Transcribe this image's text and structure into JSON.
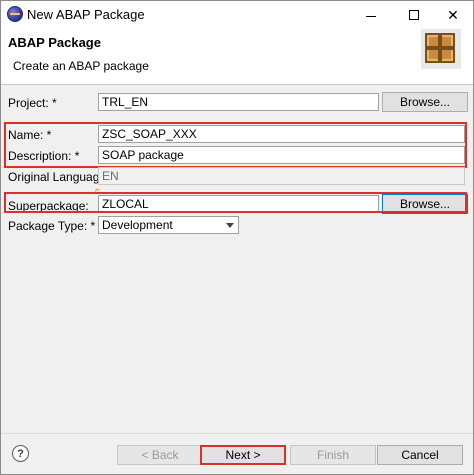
{
  "window": {
    "title": "New ABAP Package",
    "controls": {
      "minimize": "—",
      "maximize": "",
      "close": "✕"
    }
  },
  "banner": {
    "title": "ABAP Package",
    "subtitle": "Create an ABAP package",
    "icon": "package-icon"
  },
  "form": {
    "project": {
      "label": "Project: *",
      "value": "TRL_EN",
      "browse": "Browse..."
    },
    "name": {
      "label": "Name: *",
      "value": "ZSC_SOAP_XXX"
    },
    "description": {
      "label": "Description: *",
      "value": "SOAP package"
    },
    "original_language": {
      "label": "Original Language:",
      "value": "EN"
    },
    "superpackage": {
      "label": "Superpackage:",
      "value": "ZLOCAL",
      "browse": "Browse..."
    },
    "package_type": {
      "label": "Package Type: *",
      "value": "Development"
    }
  },
  "footer": {
    "help": "?",
    "back": "< Back",
    "next": "Next >",
    "finish": "Finish",
    "cancel": "Cancel"
  },
  "colors": {
    "highlight": "#d9322b",
    "focus": "#0078d7"
  }
}
